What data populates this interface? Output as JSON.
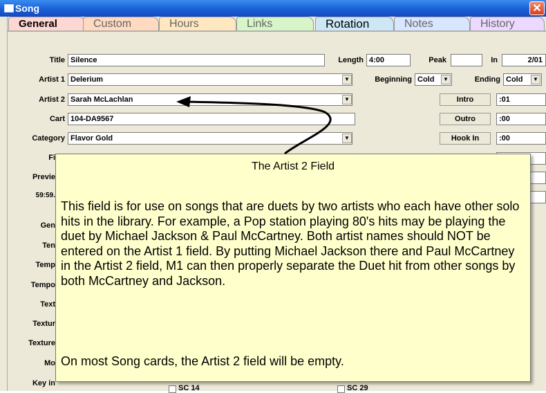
{
  "window": {
    "title": "Song",
    "close_glyph": "✕",
    "title_icon": "window-icon"
  },
  "tabs": [
    {
      "label": "General",
      "color": "#ffd7d2"
    },
    {
      "label": "Custom",
      "color": "#ffd9c0"
    },
    {
      "label": "Hours",
      "color": "#ffe8c0"
    },
    {
      "label": "Links",
      "color": "#d8f5c8"
    },
    {
      "label": "Rotation",
      "color": "#cde7f5"
    },
    {
      "label": "Notes",
      "color": "#d9e6ff"
    },
    {
      "label": "History",
      "color": "#ecd9ff"
    }
  ],
  "form": {
    "title_label": "Title",
    "title_value": "Silence",
    "length_label": "Length",
    "length_value": "4:00",
    "peak_label": "Peak",
    "peak_value": "",
    "in_label": "In",
    "in_value": "2/01",
    "artist1_label": "Artist 1",
    "artist1_value": "Delerium",
    "beginning_label": "Beginning",
    "beginning_value": "Cold",
    "ending_label": "Ending",
    "ending_value": "Cold",
    "artist2_label": "Artist 2",
    "artist2_value": "Sarah McLachlan",
    "intro_label": "Intro",
    "intro_value": ":01",
    "cart_label": "Cart",
    "cart_value": "104-DA9567",
    "outro_label": "Outro",
    "outro_value": ":00",
    "category_label": "Category",
    "category_value": "Flavor Gold",
    "hookin_label": "Hook In",
    "hookin_value": ":00",
    "partial_labels": [
      "Fi",
      "Previe",
      "59:59.",
      "Gen",
      "Ten",
      "Temp",
      "Tempo",
      "Text",
      "Textur",
      "Texture",
      "Mo",
      "Key in"
    ],
    "partial_values": [
      "00",
      "00",
      "4:00"
    ],
    "sc_labels": [
      "SC 14",
      "SC 29"
    ],
    "dropdown_glyph": "▼"
  },
  "callout": {
    "title": "The Artist 2 Field",
    "body": "This field is for use on songs that are duets by two artists who each have other solo hits in the library.  For example, a Pop station playing 80's hits may be playing the duet by Michael Jackson & Paul McCartney.  Both artist names should NOT be entered on the Artist 1 field.  By putting Michael Jackson there and Paul McCartney in the Artist 2 field, M1 can then properly separate the Duet hit from other songs by both McCartney and Jackson.",
    "footer": "On most Song cards, the Artist 2 field will be empty."
  }
}
